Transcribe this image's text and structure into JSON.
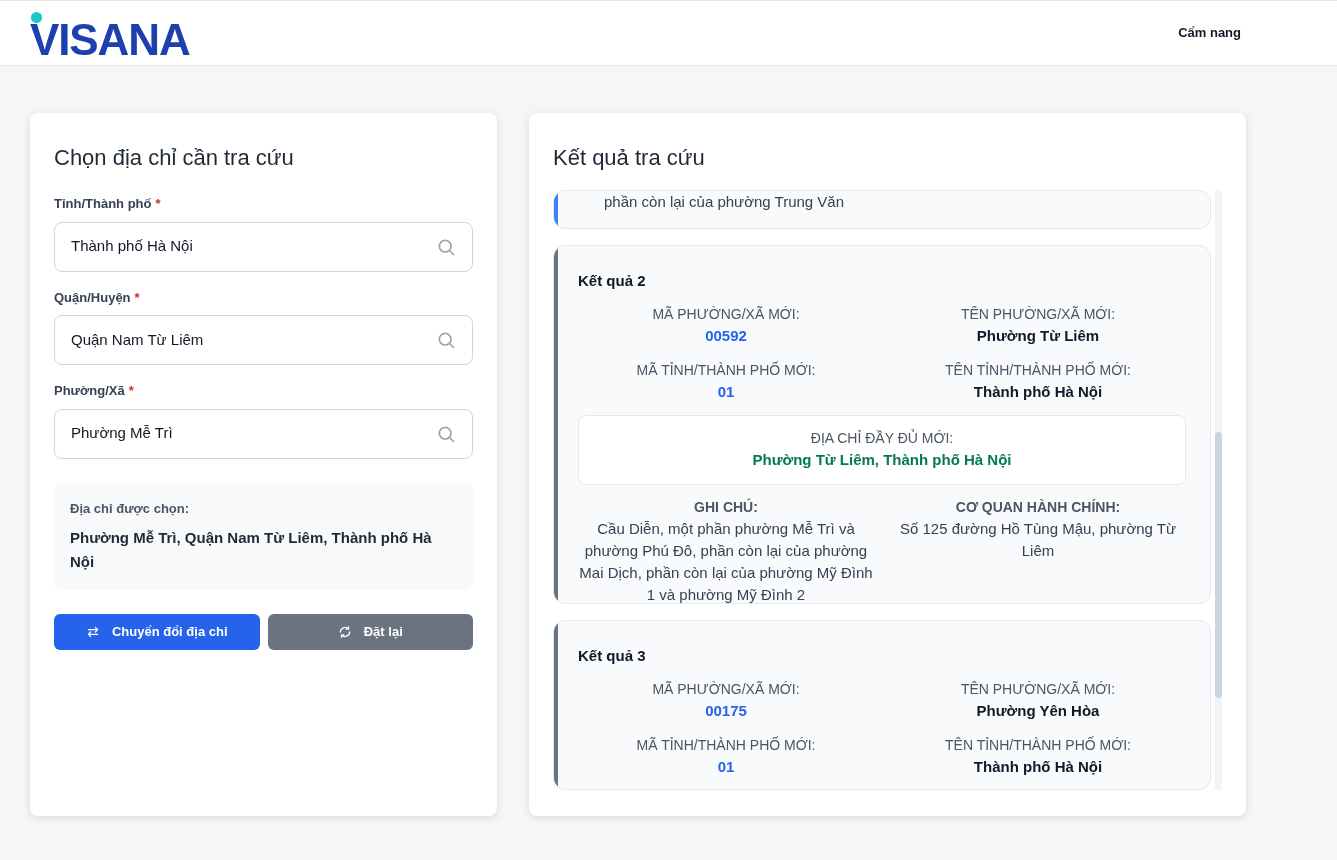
{
  "header": {
    "logo": "VISANA",
    "nav": [
      {
        "label": "Cẩm nang"
      }
    ]
  },
  "form": {
    "title": "Chọn địa chỉ cần tra cứu",
    "fields": [
      {
        "label": "Tỉnh/Thành phố",
        "required_mark": "*",
        "value": "Thành phố Hà Nội"
      },
      {
        "label": "Quận/Huyện",
        "required_mark": "*",
        "value": "Quận Nam Từ Liêm"
      },
      {
        "label": "Phường/Xã",
        "required_mark": "*",
        "value": "Phường Mễ Trì"
      }
    ],
    "selected": {
      "label": "Địa chỉ được chọn:",
      "value": "Phường Mễ Trì, Quận Nam Từ Liêm, Thành phố Hà Nội"
    },
    "buttons": [
      {
        "kind": "primary",
        "label": "Chuyển đổi địa chỉ"
      },
      {
        "kind": "secondary",
        "label": "Đặt lại"
      }
    ]
  },
  "results": {
    "title": "Kết quả tra cứu",
    "items": [
      {
        "kind": "partial",
        "color": "#3b82f6",
        "text": "phần còn lại của phường Trung Văn"
      },
      {
        "kind": "full",
        "color": "#6b7280",
        "title": "Kết quả 2",
        "fields": [
          {
            "label": "MÃ PHƯỜNG/XÃ MỚI:",
            "value": "00592"
          },
          {
            "label": "TÊN PHƯỜNG/XÃ MỚI:",
            "value": "Phường Từ Liêm"
          },
          {
            "label": "MÃ TỈNH/THÀNH PHỐ MỚI:",
            "value": "01"
          },
          {
            "label": "TÊN TỈNH/THÀNH PHỐ MỚI:",
            "value": "Thành phố Hà Nội"
          }
        ],
        "full_address": {
          "label": "ĐỊA CHỈ ĐẦY ĐỦ MỚI:",
          "value": "Phường Từ Liêm, Thành phố Hà Nội"
        },
        "notes": [
          {
            "label": "GHI CHÚ:",
            "value": "Cầu Diễn, một phần phường Mễ Trì và phường Phú Đô, phần còn lại của phường Mai Dịch, phần còn lại của phường Mỹ Đình 1 và phường Mỹ Đình 2"
          },
          {
            "label": "CƠ QUAN HÀNH CHÍNH:",
            "value": "Số 125 đường Hồ Tùng Mậu, phường Từ Liêm"
          }
        ]
      },
      {
        "kind": "full",
        "color": "#6b7280",
        "title": "Kết quả 3",
        "fields": [
          {
            "label": "MÃ PHƯỜNG/XÃ MỚI:",
            "value": "00175"
          },
          {
            "label": "TÊN PHƯỜNG/XÃ MỚI:",
            "value": "Phường Yên Hòa"
          },
          {
            "label": "MÃ TỈNH/THÀNH PHỐ MỚI:",
            "value": "01"
          },
          {
            "label": "TÊN TỈNH/THÀNH PHỐ MỚI:",
            "value": "Thành phố Hà Nội"
          }
        ]
      }
    ]
  }
}
